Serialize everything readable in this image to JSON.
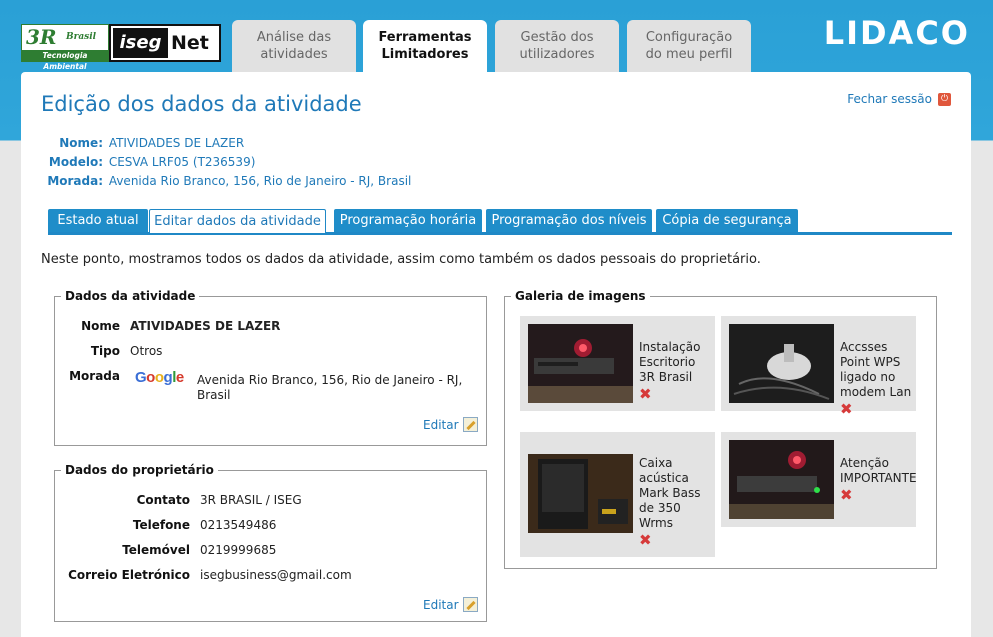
{
  "header": {
    "logo_3r_big": "3R",
    "logo_3r_small": "Brasil",
    "logo_3r_strip": "Tecnologia Ambiental",
    "logo_iseg_a": "iseg",
    "logo_iseg_b": "Net",
    "brand": "LIDACO",
    "tabs": [
      {
        "line1": "Análise das",
        "line2": "atividades"
      },
      {
        "line1": "Ferramentas",
        "line2": "Limitadores"
      },
      {
        "line1": "Gestão dos",
        "line2": "utilizadores"
      },
      {
        "line1": "Configuração",
        "line2": "do meu perfil"
      }
    ]
  },
  "page": {
    "title": "Edição dos dados da atividade",
    "logout": "Fechar sessão",
    "info": {
      "nome_label": "Nome:",
      "nome": "ATIVIDADES DE LAZER",
      "modelo_label": "Modelo:",
      "modelo": "CESVA LRF05 (T236539)",
      "morada_label": "Morada:",
      "morada": "Avenida Rio Branco, 156, Rio de Janeiro - RJ, Brasil"
    },
    "subtabs": [
      "Estado atual",
      "Editar dados da atividade",
      "Programação horária",
      "Programação dos níveis",
      "Cópia de segurança"
    ],
    "intro": "Neste ponto, mostramos todos os dados da atividade, assim como também os dados pessoais do proprietário."
  },
  "activity": {
    "legend": "Dados da atividade",
    "nome_label": "Nome",
    "nome": "ATIVIDADES DE LAZER",
    "tipo_label": "Tipo",
    "tipo": "Otros",
    "morada_label": "Morada",
    "google": "Google",
    "morada_line1": "Avenida Rio Branco, 156, Rio de Janeiro - RJ,",
    "morada_line2": "Brasil",
    "edit": "Editar"
  },
  "owner": {
    "legend": "Dados do proprietário",
    "contato_label": "Contato",
    "contato": "3R BRASIL / ISEG",
    "telefone_label": "Telefone",
    "telefone": "0213549486",
    "telemovel_label": "Telemóvel",
    "telemovel": "0219999685",
    "correio_label": "Correio Eletrónico",
    "correio": "isegbusiness@gmail.com",
    "edit": "Editar"
  },
  "gallery": {
    "legend": "Galeria de imagens",
    "items": [
      {
        "caption": "Instalação Escritorio 3R Brasil"
      },
      {
        "caption": "Accsses Point WPS ligado no modem Lan"
      },
      {
        "caption": "Caixa acústica Mark Bass de 350 Wrms"
      },
      {
        "caption": "Atenção IMPORTANTE"
      }
    ]
  }
}
